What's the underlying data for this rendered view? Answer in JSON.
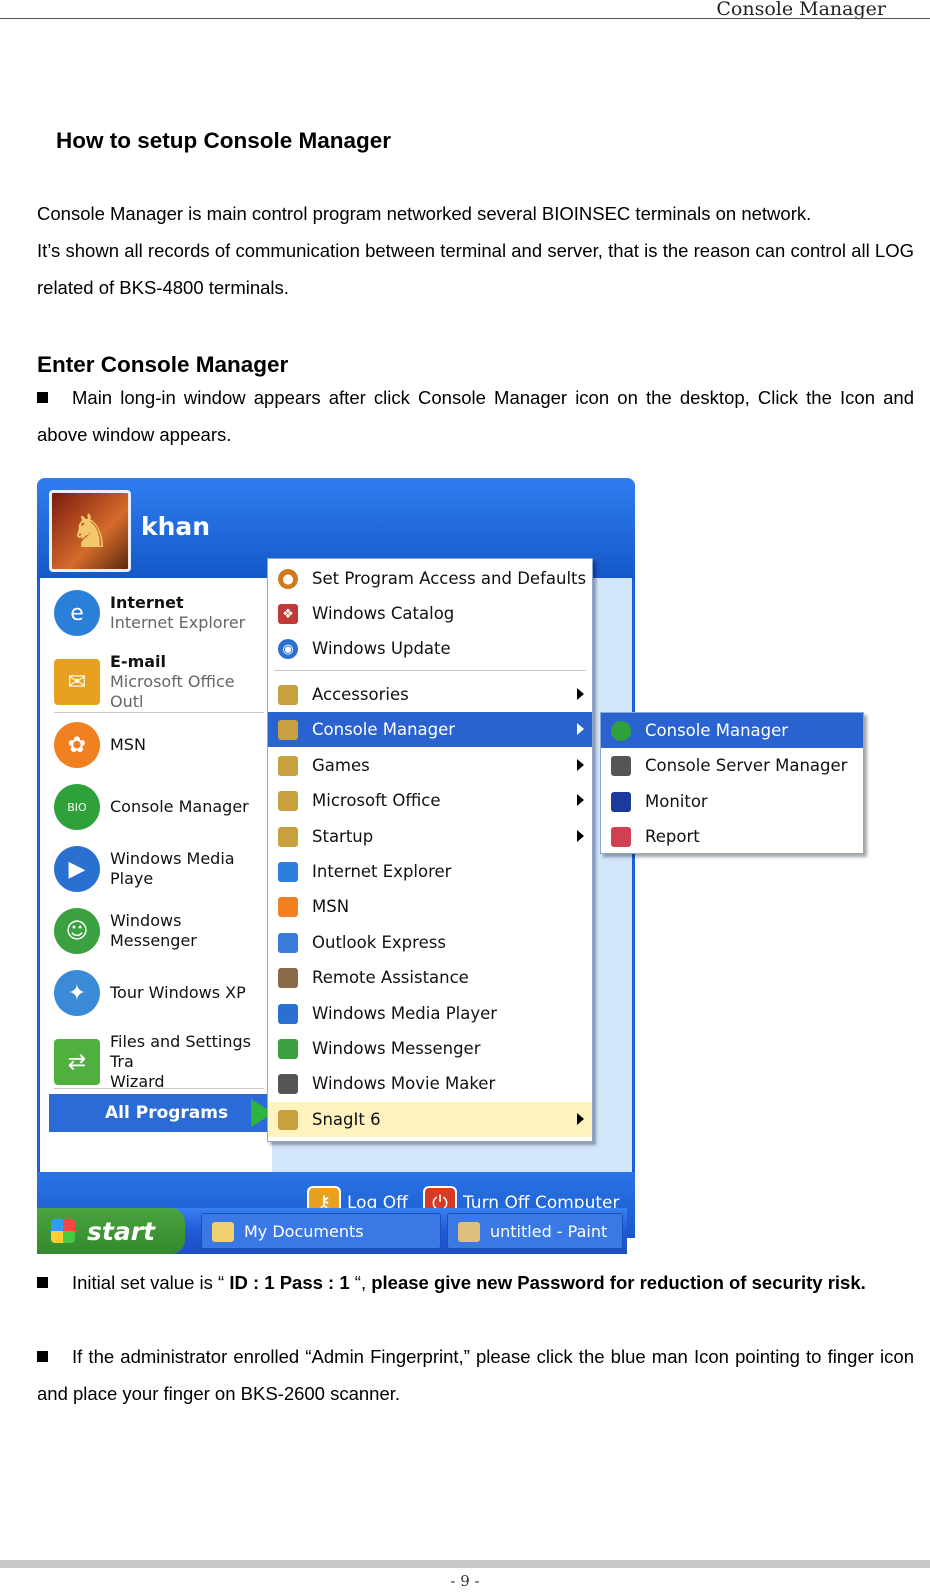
{
  "header": {
    "title": "Console Manager"
  },
  "doc": {
    "heading": "How to setup Console Manager",
    "intro_line1": "Console Manager is main control program networked several BIOINSEC terminals on network.",
    "intro_line2": "It’s shown all records of communication between terminal and server, that is the reason can control all LOG related of BKS-4800 terminals.",
    "section_title": "Enter Console Manager",
    "bullet1": "Main long-in window appears after click Console Manager icon on the desktop, Click the Icon and above window appears.",
    "bullet2_prefix": "Initial set value is “ ",
    "bullet2_bold1": "ID : 1 Pass : 1",
    "bullet2_mid": " “, ",
    "bullet2_bold2": "please give new Password for reduction of security risk.",
    "bullet3": "If the administrator enrolled “Admin Fingerprint,” please click the blue man Icon pointing to finger icon and place your finger on BKS-2600 scanner."
  },
  "start_menu": {
    "user": "khan",
    "pinned": [
      {
        "title": "Internet",
        "subtitle": "Internet Explorer",
        "icon": "internet-explorer-icon",
        "color": "#2a7fd8"
      },
      {
        "title": "E-mail",
        "subtitle": "Microsoft Office Outl",
        "icon": "outlook-icon",
        "color": "#e8a020"
      }
    ],
    "recent": [
      {
        "label": "MSN",
        "icon": "msn-butterfly-icon",
        "color": "#f08020"
      },
      {
        "label": "Console Manager",
        "icon": "bio-console-icon",
        "color": "#2fa13a"
      },
      {
        "label": "Windows Media Playe",
        "icon": "media-player-icon",
        "color": "#2a70d0"
      },
      {
        "label": "Windows Messenger",
        "icon": "messenger-icon",
        "color": "#3aa040"
      },
      {
        "label": "Tour Windows XP",
        "icon": "tour-icon",
        "color": "#3a8ad8"
      },
      {
        "label": "Files and Settings Tra",
        "label2": "Wizard",
        "icon": "transfer-wizard-icon",
        "color": "#4fb040"
      }
    ],
    "all_programs": "All Programs",
    "log_off": "Log Off",
    "turn_off": "Turn Off Computer"
  },
  "programs_menu": {
    "top_items": [
      {
        "label": "Set Program Access and Defaults",
        "icon": "program-access-icon",
        "color": "#d07a20"
      },
      {
        "label": "Windows Catalog",
        "icon": "catalog-icon",
        "color": "#c03a3a"
      },
      {
        "label": "Windows Update",
        "icon": "update-icon",
        "color": "#2a70d0"
      }
    ],
    "items": [
      {
        "label": "Accessories",
        "icon": "folder-icon",
        "submenu": true
      },
      {
        "label": "Console Manager",
        "icon": "folder-icon",
        "submenu": true,
        "highlighted": true
      },
      {
        "label": "Games",
        "icon": "folder-icon",
        "submenu": true
      },
      {
        "label": "Microsoft Office",
        "icon": "folder-icon",
        "submenu": true
      },
      {
        "label": "Startup",
        "icon": "folder-icon",
        "submenu": true
      },
      {
        "label": "Internet Explorer",
        "icon": "internet-explorer-icon"
      },
      {
        "label": "MSN",
        "icon": "msn-butterfly-icon"
      },
      {
        "label": "Outlook Express",
        "icon": "outlook-express-icon"
      },
      {
        "label": "Remote Assistance",
        "icon": "remote-assistance-icon"
      },
      {
        "label": "Windows Media Player",
        "icon": "media-player-icon"
      },
      {
        "label": "Windows Messenger",
        "icon": "messenger-icon"
      },
      {
        "label": "Windows Movie Maker",
        "icon": "movie-maker-icon"
      },
      {
        "label": "SnagIt  6",
        "icon": "folder-icon",
        "submenu": true,
        "new": true
      }
    ]
  },
  "console_submenu": {
    "items": [
      {
        "label": "Console Manager",
        "icon": "console-manager-icon",
        "highlighted": true,
        "color": "#2fa13a"
      },
      {
        "label": "Console Server Manager",
        "icon": "server-manager-icon",
        "color": "#555555"
      },
      {
        "label": "Monitor",
        "icon": "monitor-icon",
        "color": "#1c3a9c"
      },
      {
        "label": "Report",
        "icon": "report-icon",
        "color": "#d04050"
      }
    ]
  },
  "taskbar": {
    "start": "start",
    "buttons": [
      {
        "label": "My Documents",
        "icon": "my-documents-icon"
      },
      {
        "label": "untitled - Paint",
        "icon": "paint-icon"
      }
    ]
  },
  "footer": {
    "page": "- 9 -"
  }
}
